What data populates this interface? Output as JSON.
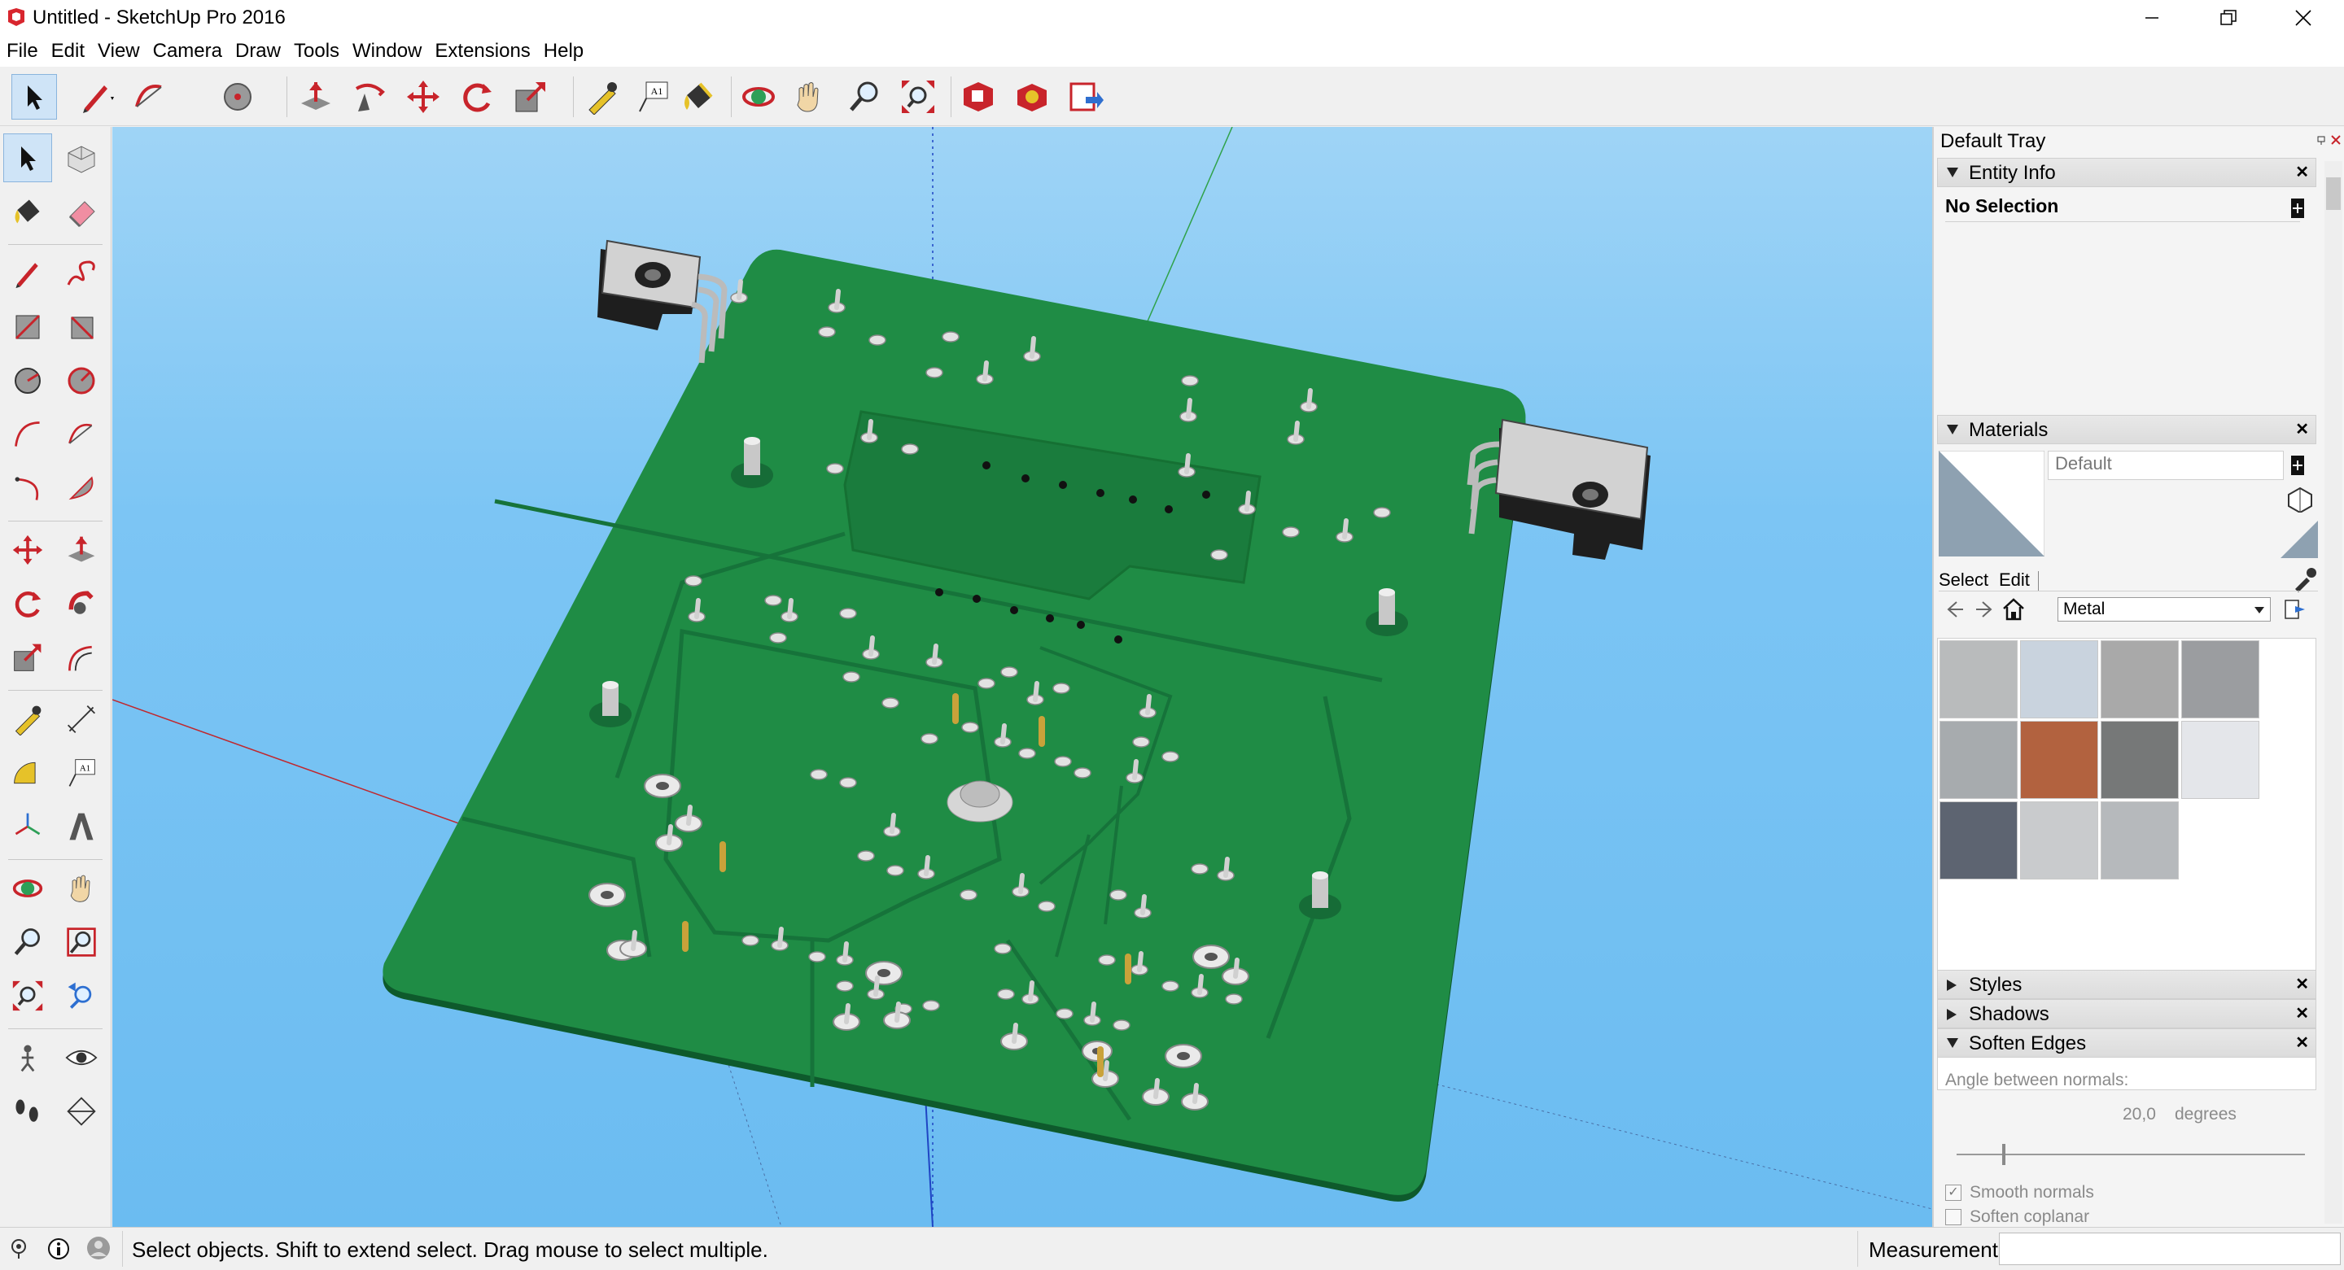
{
  "window": {
    "title": "Untitled - SketchUp Pro 2016",
    "minimize_label": "–",
    "restore_label": "❐",
    "close_label": "✕"
  },
  "menu": [
    "File",
    "Edit",
    "View",
    "Camera",
    "Draw",
    "Tools",
    "Window",
    "Extensions",
    "Help"
  ],
  "toolbar": {
    "text_tool_glyph": "A1"
  },
  "left_toolbar": {
    "text_tool_glyph": "A1"
  },
  "tray": {
    "title": "Default Tray",
    "entity_info": {
      "title": "Entity Info",
      "selection": "No Selection"
    },
    "materials": {
      "title": "Materials",
      "material_name": "Default",
      "tab_select": "Select",
      "tab_edit": "Edit",
      "library": "Metal",
      "swatch_colors": [
        "#b9bbbc",
        "#c9d3de",
        "#a9a9a9",
        "#9b9da0",
        "#a7abae",
        "#b2623f",
        "#767878",
        "#e4e6ea",
        "#5d6471",
        "#c9cbcd",
        "#b6b9bc"
      ]
    },
    "styles": {
      "title": "Styles"
    },
    "shadows": {
      "title": "Shadows"
    },
    "soften_edges": {
      "title": "Soften Edges",
      "angle_label": "Angle between normals:",
      "angle_value": "20,0",
      "angle_unit": "degrees",
      "smooth_normals_label": "Smooth normals",
      "smooth_normals_checked": true,
      "soften_coplanar_label": "Soften coplanar",
      "soften_coplanar_checked": false
    }
  },
  "status": {
    "text": "Select objects. Shift to extend select. Drag mouse to select multiple.",
    "measurements_label": "Measurements",
    "measurements_value": ""
  }
}
